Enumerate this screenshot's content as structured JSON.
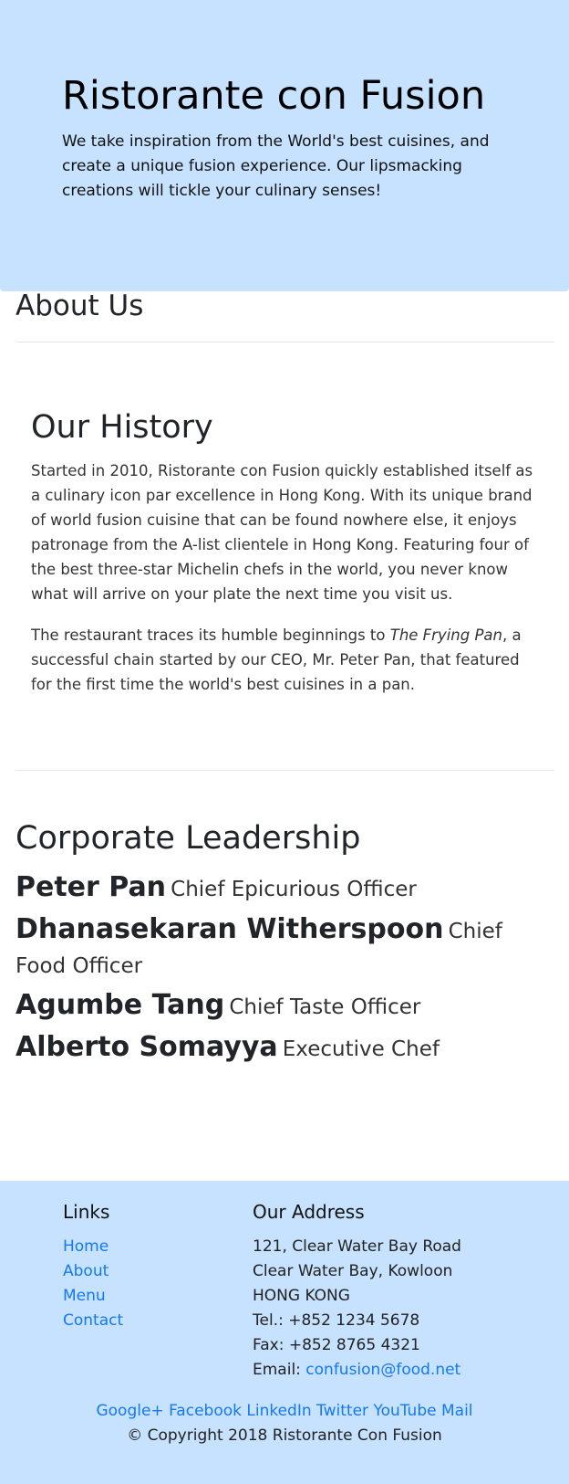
{
  "header": {
    "title": "Ristorante con Fusion",
    "tagline": "We take inspiration from the World's best cuisines, and create a unique fusion experience. Our lipsmacking creations will tickle your culinary senses!"
  },
  "about": {
    "heading": "About Us",
    "history_heading": "Our History",
    "history_p1": "Started in 2010, Ristorante con Fusion quickly established itself as a culinary icon par excellence in Hong Kong. With its unique brand of world fusion cuisine that can be found nowhere else, it enjoys patronage from the A-list clientele in Hong Kong. Featuring four of the best three-star Michelin chefs in the world, you never know what will arrive on your plate the next time you visit us.",
    "history_p2_before": "The restaurant traces its humble beginnings to ",
    "history_p2_em": "The Frying Pan",
    "history_p2_after": ", a successful chain started by our CEO, Mr. Peter Pan, that featured for the first time the world's best cuisines in a pan."
  },
  "leadership": {
    "heading": "Corporate Leadership",
    "leaders": [
      {
        "name": "Peter Pan",
        "title": "Chief Epicurious Officer"
      },
      {
        "name": "Dhanasekaran Witherspoon",
        "title": "Chief Food Officer"
      },
      {
        "name": "Agumbe Tang",
        "title": "Chief Taste Officer"
      },
      {
        "name": "Alberto Somayya",
        "title": "Executive Chef"
      }
    ]
  },
  "footer": {
    "links_heading": "Links",
    "links": [
      "Home",
      "About",
      "Menu",
      "Contact"
    ],
    "address_heading": "Our Address",
    "address_lines": [
      "121, Clear Water Bay Road",
      "Clear Water Bay, Kowloon",
      "HONG KONG",
      "Tel.: +852 1234 5678",
      "Fax: +852 8765 4321"
    ],
    "email_label": "Email: ",
    "email": "confusion@food.net",
    "social": [
      "Google+",
      "Facebook",
      "LinkedIn",
      "Twitter",
      "YouTube",
      "Mail"
    ],
    "copyright": "© Copyright 2018 Ristorante Con Fusion"
  },
  "colors": {
    "jumbotron_bg": "#c6e2fe",
    "link": "#1479ee",
    "text": "#212529"
  }
}
